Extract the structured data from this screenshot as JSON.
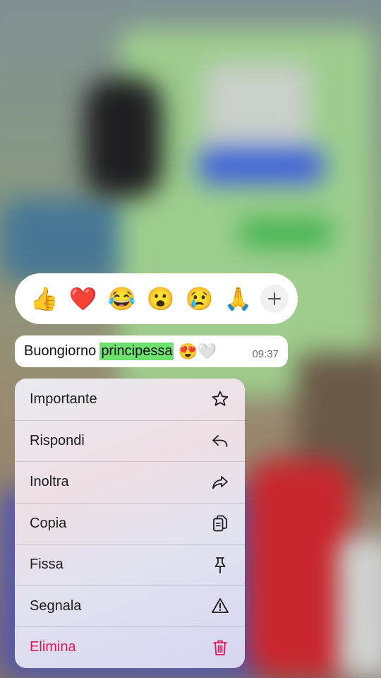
{
  "reactions": {
    "emojis": [
      "👍",
      "❤️",
      "😂",
      "😮",
      "😢",
      "🙏"
    ],
    "more_label": "+"
  },
  "message": {
    "text_before": "Buongiorno",
    "highlight": "principessa",
    "emojis": "😍🤍",
    "time": "09:37",
    "highlight_color": "#6ee26e"
  },
  "menu": {
    "items": [
      {
        "label": "Importante",
        "icon": "star-icon"
      },
      {
        "label": "Rispondi",
        "icon": "reply-icon"
      },
      {
        "label": "Inoltra",
        "icon": "forward-icon"
      },
      {
        "label": "Copia",
        "icon": "copy-icon"
      },
      {
        "label": "Fissa",
        "icon": "pin-icon"
      },
      {
        "label": "Segnala",
        "icon": "warning-icon"
      },
      {
        "label": "Elimina",
        "icon": "trash-icon",
        "danger": true
      }
    ],
    "danger_color": "#e4165a"
  }
}
